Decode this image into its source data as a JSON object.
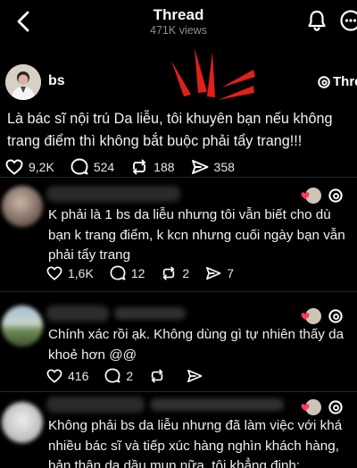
{
  "header": {
    "title": "Thread",
    "views": "471K views"
  },
  "post": {
    "author": "bs",
    "threads_link": "Threa",
    "text": "Là bác sĩ nội trú Da liễu, tôi khuyên bạn nếu không trang điểm thì không bắt buộc phải tẩy trang!!!",
    "likes": "9,2K",
    "comments": "524",
    "reposts": "188",
    "shares": "358"
  },
  "replies": [
    {
      "text": "K phải là 1 bs da liễu nhưng tôi vẫn biết cho dù bạn k trang điểm, k kcn nhưng cuối ngày bạn vẫn phải tẩy trang",
      "likes": "1,6K",
      "comments": "12",
      "reposts": "2",
      "shares": "7"
    },
    {
      "text": "Chính xác rồi ạk. Không dùng gì tự nhiên thấy da khoẻ hơn @@",
      "likes": "416",
      "comments": "2",
      "reposts": "",
      "shares": ""
    },
    {
      "text": "Không phải bs da liễu nhưng đã làm việc với khá nhiều bác sĩ  và tiếp xúc hàng nghìn khách hàng, bản thân da dầu mụn nữa, tôi khẳng định:"
    }
  ],
  "colors": {
    "background": "#000000",
    "text": "#f3f3f3",
    "muted": "#8d8d8d",
    "annotation_red": "#e0201a",
    "heart": "#ff3b5c"
  },
  "icons": [
    "back-chevron-icon",
    "bell-icon",
    "more-icon",
    "threads-logo-icon",
    "heart-icon",
    "comment-icon",
    "repost-icon",
    "share-icon"
  ]
}
